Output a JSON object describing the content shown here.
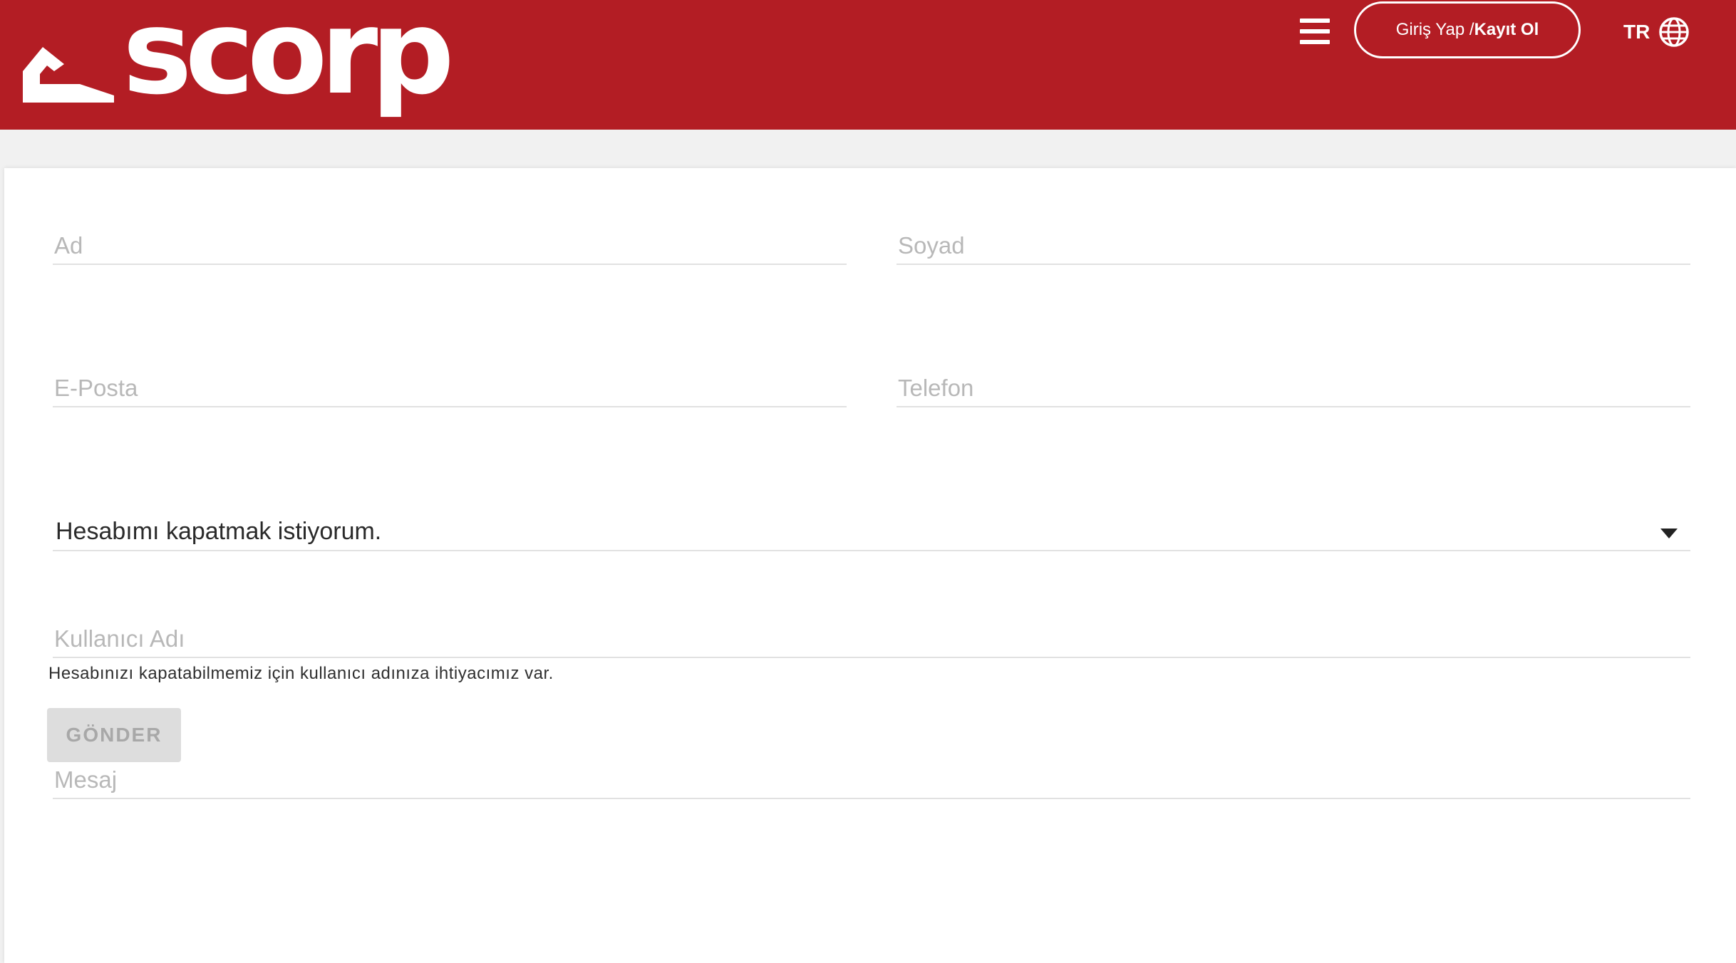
{
  "header": {
    "logo_text": "scorp",
    "menu_icon": "hamburger-menu-icon",
    "login_part1": "Giriş Yap / ",
    "login_part2": "Kayıt Ol",
    "language": "TR",
    "globe_icon": "globe-icon",
    "brand_color": "#b31d24"
  },
  "form": {
    "first_name_placeholder": "Ad",
    "last_name_placeholder": "Soyad",
    "email_placeholder": "E-Posta",
    "phone_placeholder": "Telefon",
    "topic_selected": "Hesabımı kapatmak istiyorum.",
    "username_placeholder": "Kullanıcı Adı",
    "username_hint": "Hesabınızı kapatabilmemiz için kullanıcı adınıza ihtiyacımız var.",
    "message_placeholder": "Mesaj",
    "submit_label": "GÖNDER"
  }
}
